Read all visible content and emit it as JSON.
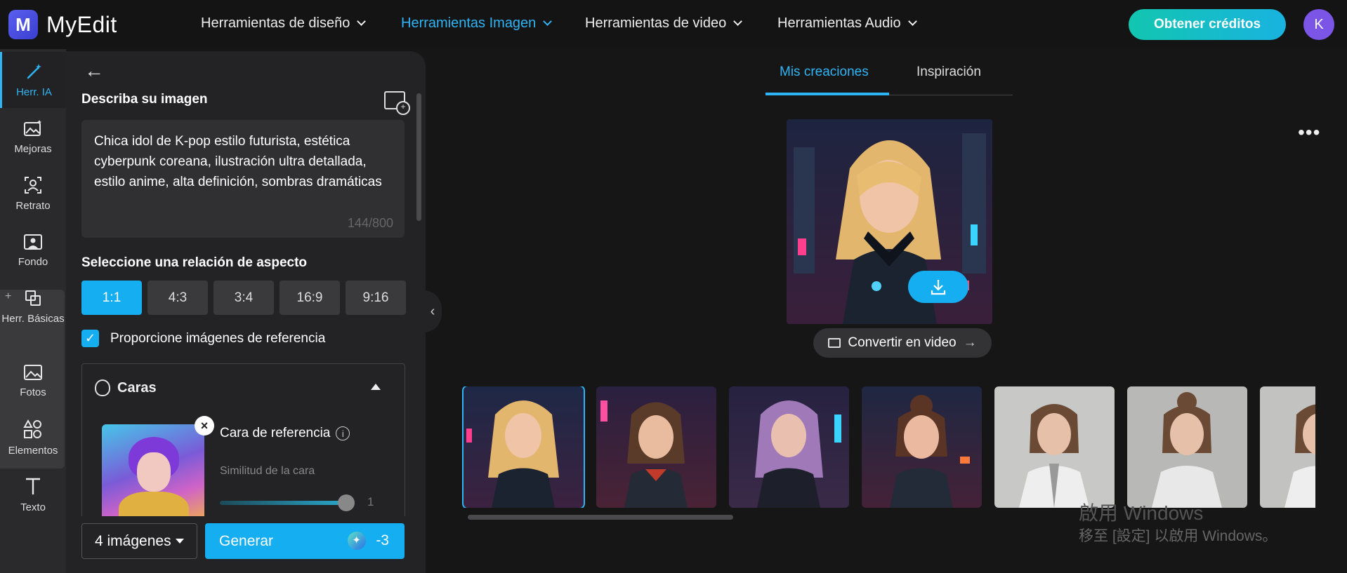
{
  "header": {
    "logo_letter": "M",
    "brand": "MyEdit",
    "nav": [
      {
        "label": "Herramientas de diseño",
        "active": false
      },
      {
        "label": "Herramientas Imagen",
        "active": true
      },
      {
        "label": "Herramientas de video",
        "active": false
      },
      {
        "label": "Herramientas Audio",
        "active": false
      }
    ],
    "credits_button": "Obtener créditos",
    "avatar_initial": "K"
  },
  "rail": {
    "items": [
      {
        "label": "Herr. IA",
        "icon": "magic-wand-icon",
        "active": true
      },
      {
        "label": "Mejoras",
        "icon": "image-enhance-icon",
        "active": false
      },
      {
        "label": "Retrato",
        "icon": "portrait-icon",
        "active": false
      },
      {
        "label": "Fondo",
        "icon": "background-icon",
        "active": false
      },
      {
        "label": "Herr. Básicas",
        "icon": "basic-tools-icon",
        "active": false
      },
      {
        "label": "Fotos",
        "icon": "photos-icon",
        "active": false
      },
      {
        "label": "Elementos",
        "icon": "elements-icon",
        "active": false
      },
      {
        "label": "Texto",
        "icon": "text-icon",
        "active": false
      }
    ],
    "plus": "+"
  },
  "panel": {
    "describe_title": "Describa su imagen",
    "prompt": "Chica idol de K-pop estilo futurista, estética cyberpunk coreana, ilustración ultra detallada, estilo anime, alta definición, sombras dramáticas",
    "prompt_count": "144/800",
    "aspect_title": "Seleccione una relación de aspecto",
    "ratios": [
      {
        "label": "1:1",
        "active": true
      },
      {
        "label": "4:3",
        "active": false
      },
      {
        "label": "3:4",
        "active": false
      },
      {
        "label": "16:9",
        "active": false
      },
      {
        "label": "9:16",
        "active": false
      }
    ],
    "reference_checkbox_label": "Proporcione imágenes de referencia",
    "reference_checked": true,
    "faces_title": "Caras",
    "face_ref_label": "Cara de referencia",
    "info_glyph": "i",
    "similarity_label": "Similitud de la cara",
    "similarity_value": "1",
    "image_count": "4 imágenes",
    "generate_label": "Generar",
    "generate_cost": "-3"
  },
  "main": {
    "tabs": [
      {
        "label": "Mis creaciones",
        "active": true
      },
      {
        "label": "Inspiración",
        "active": false
      }
    ],
    "convert_label": "Convertir en video",
    "thumbnails": [
      {
        "style": "blonde-neon",
        "selected": true
      },
      {
        "style": "brunette-red",
        "selected": false
      },
      {
        "style": "purple-hair",
        "selected": false
      },
      {
        "style": "bun-neon",
        "selected": false
      },
      {
        "style": "white-suit",
        "selected": false
      },
      {
        "style": "white-suit-2",
        "selected": false
      },
      {
        "style": "white-suit-3",
        "selected": false
      }
    ]
  },
  "watermark": {
    "line1": "啟用 Windows",
    "line2": "移至 [設定] 以啟用 Windows。"
  },
  "colors": {
    "accent": "#15aef0",
    "credits_gradient_start": "#12c6b0",
    "avatar": "#7b55e6"
  }
}
